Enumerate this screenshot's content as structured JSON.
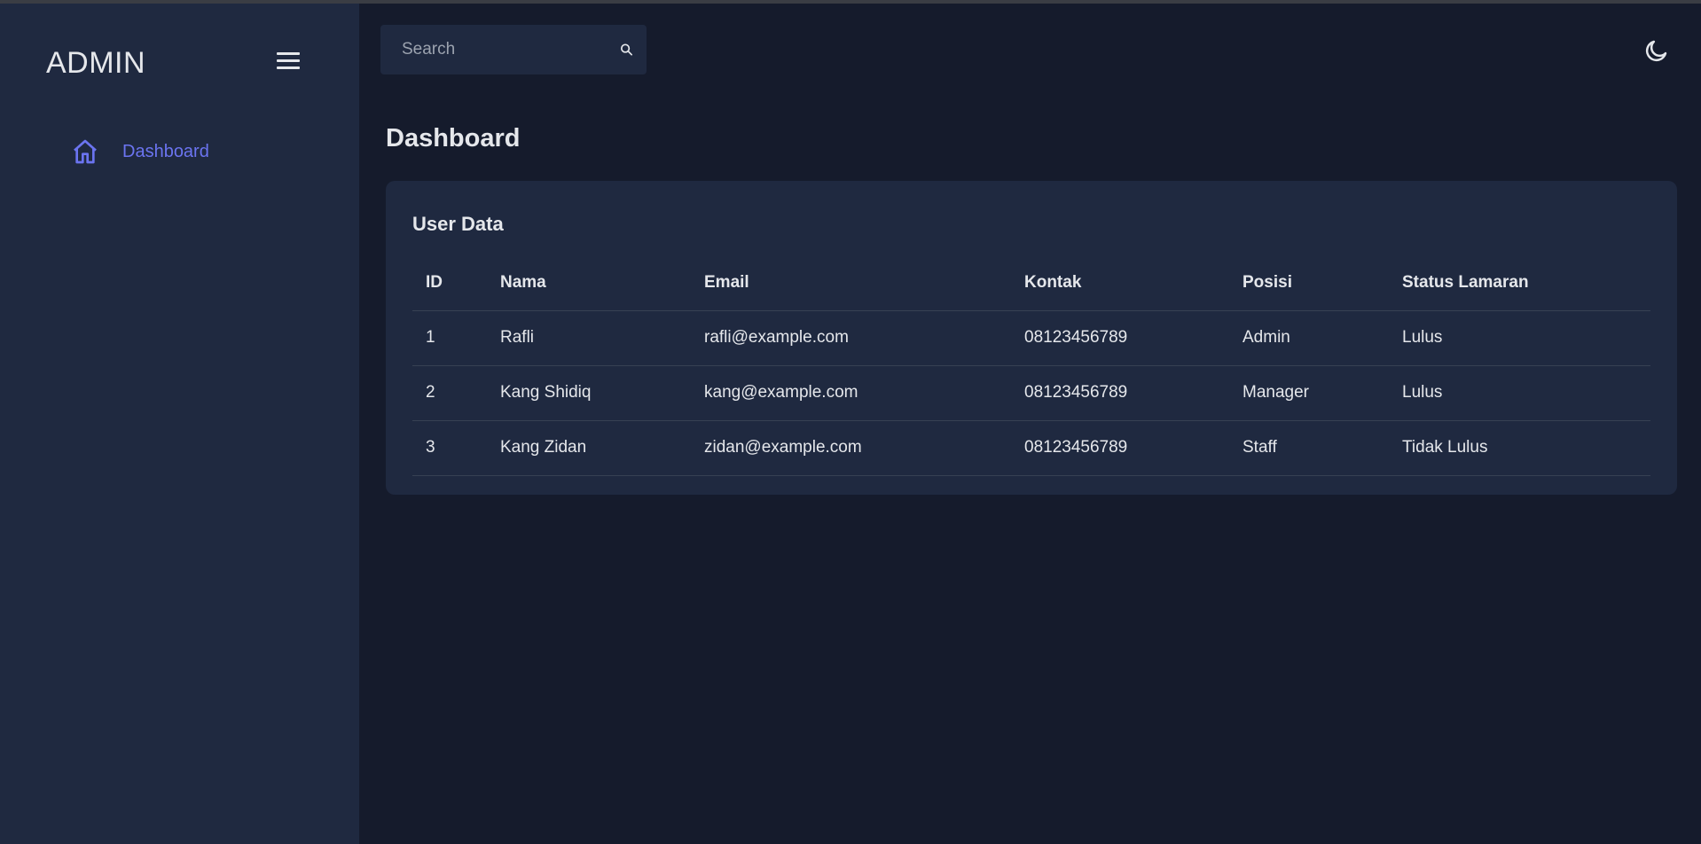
{
  "sidebar": {
    "brand": "ADMIN",
    "menu_icon": "hamburger-menu-icon",
    "items": [
      {
        "label": "Dashboard",
        "icon": "home-icon",
        "active": true,
        "color": "#6b74f0"
      }
    ]
  },
  "header": {
    "search": {
      "placeholder": "Search",
      "value": "",
      "icon": "search-icon"
    },
    "theme_icon": "moon-icon"
  },
  "main": {
    "title": "Dashboard",
    "card": {
      "title": "User Data",
      "columns": [
        "ID",
        "Nama",
        "Email",
        "Kontak",
        "Posisi",
        "Status Lamaran"
      ],
      "rows": [
        {
          "id": "1",
          "nama": "Rafli",
          "email": "rafli@example.com",
          "kontak": "08123456789",
          "posisi": "Admin",
          "status": "Lulus"
        },
        {
          "id": "2",
          "nama": "Kang Shidiq",
          "email": "kang@example.com",
          "kontak": "08123456789",
          "posisi": "Manager",
          "status": "Lulus"
        },
        {
          "id": "3",
          "nama": "Kang Zidan",
          "email": "zidan@example.com",
          "kontak": "08123456789",
          "posisi": "Staff",
          "status": "Tidak Lulus"
        }
      ]
    }
  },
  "colors": {
    "sidebar_bg": "#1f2940",
    "main_bg": "#151b2c",
    "accent": "#6b74f0",
    "text": "#e5e7eb"
  }
}
